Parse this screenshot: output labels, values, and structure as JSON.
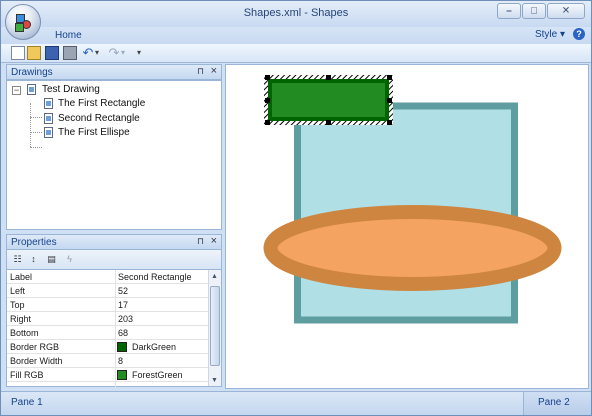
{
  "window": {
    "title": "Shapes.xml - Shapes"
  },
  "ribbon": {
    "tab_home": "Home",
    "style_menu": "Style",
    "help_glyph": "?"
  },
  "toolbar": {
    "icons": [
      "new-icon",
      "open-icon",
      "save-icon",
      "print-icon",
      "undo-icon",
      "redo-icon",
      "customize-icon"
    ]
  },
  "drawings_panel": {
    "title": "Drawings",
    "tree": {
      "root": "Test Drawing",
      "children": [
        "The First Rectangle",
        "Second Rectangle",
        "The First Ellispe"
      ]
    }
  },
  "properties_panel": {
    "title": "Properties",
    "rows": [
      {
        "name": "Label",
        "value": "Second Rectangle"
      },
      {
        "name": "Left",
        "value": "52"
      },
      {
        "name": "Top",
        "value": "17"
      },
      {
        "name": "Right",
        "value": "203"
      },
      {
        "name": "Bottom",
        "value": "68"
      },
      {
        "name": "Border RGB",
        "value": "DarkGreen",
        "swatch": "#006400"
      },
      {
        "name": "Border Width",
        "value": "8"
      },
      {
        "name": "Fill RGB",
        "value": "ForestGreen",
        "swatch": "#228B22"
      }
    ]
  },
  "canvas": {
    "colors": {
      "rect1_fill": "#B0E0E6",
      "rect1_border": "#5F9EA0",
      "rect2_fill": "#228B22",
      "rect2_border": "#006400",
      "ellipse_fill": "#F4A460",
      "ellipse_border": "#CD853F"
    }
  },
  "statusbar": {
    "pane1": "Pane 1",
    "pane2": "Pane 2"
  }
}
